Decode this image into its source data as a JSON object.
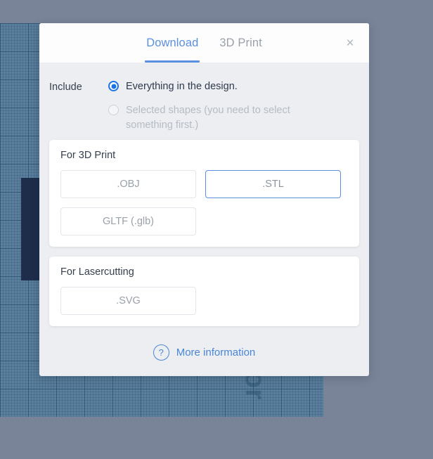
{
  "canvas": {
    "watermark_text": "Vor",
    "shape_name": "dark-rectangle"
  },
  "modal": {
    "tabs": [
      {
        "label": "Download",
        "active": true
      },
      {
        "label": "3D Print",
        "active": false
      }
    ],
    "close_label": "×",
    "include": {
      "label": "Include",
      "options": [
        {
          "text": "Everything in the design.",
          "selected": true,
          "disabled": false
        },
        {
          "text": "Selected shapes (you need to select something first.)",
          "selected": false,
          "disabled": true
        }
      ]
    },
    "sections": [
      {
        "title": "For 3D Print",
        "buttons": [
          {
            "label": ".OBJ",
            "selected": false
          },
          {
            "label": ".STL",
            "selected": true
          },
          {
            "label": "GLTF (.glb)",
            "selected": false
          }
        ]
      },
      {
        "title": "For Lasercutting",
        "buttons": [
          {
            "label": ".SVG",
            "selected": false
          }
        ]
      }
    ],
    "footer": {
      "help_glyph": "?",
      "more_information_label": "More information"
    }
  },
  "colors": {
    "accent_blue": "#5b8fe0",
    "radio_blue": "#1a73e8",
    "modal_body": "#eceef1",
    "topbar_gray": "#7a8499",
    "canvas_blue": "#5b7f9c",
    "shape_navy": "#1e2d4a",
    "muted_text": "#9aa1ab"
  }
}
